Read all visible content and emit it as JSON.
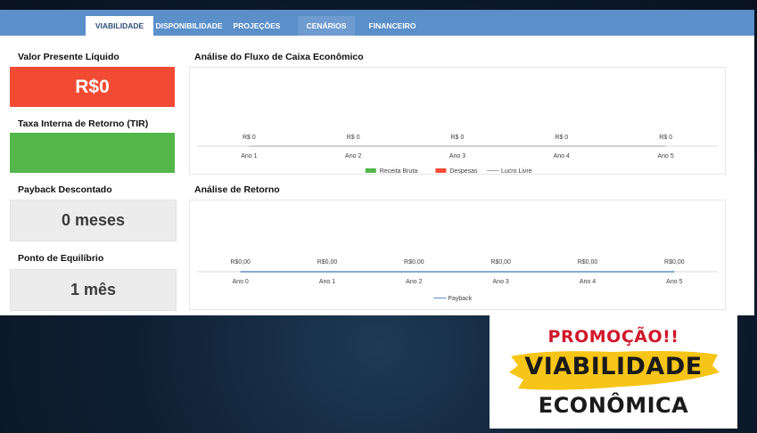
{
  "tabs": [
    {
      "label": "VIABILIDADE",
      "active": true
    },
    {
      "label": "DISPONIBILIDADE",
      "active": false
    },
    {
      "label": "PROJEÇÕES",
      "active": false
    },
    {
      "label": "CENÁRIOS",
      "active": false
    },
    {
      "label": "FINANCEIRO",
      "active": false
    }
  ],
  "kpis": {
    "vpl": {
      "label": "Valor Presente Líquido",
      "value": "R$0"
    },
    "tir": {
      "label": "Taxa Interna de Retorno (TIR)",
      "value": ""
    },
    "payback": {
      "label": "Payback Descontado",
      "value": "0 meses"
    },
    "equilibrio": {
      "label": "Ponto de Equilíbrio",
      "value": "1 mês"
    }
  },
  "colors": {
    "tabbar": "#5b8fc9",
    "red": "#f14b34",
    "green": "#54b74a",
    "line_gray": "#a5a5a5",
    "line_blue": "#5b8fc9"
  },
  "chart_data": [
    {
      "type": "bar",
      "title": "Análise do Fluxo de Caixa Econômico",
      "categories": [
        "Ano 1",
        "Ano 2",
        "Ano 3",
        "Ano 4",
        "Ano 5"
      ],
      "data_labels": [
        "R$ 0",
        "R$ 0",
        "R$ 0",
        "R$ 0",
        "R$ 0"
      ],
      "series": [
        {
          "name": "Receita Bruta",
          "type": "bar",
          "color": "#54b74a",
          "values": [
            0,
            0,
            0,
            0,
            0
          ]
        },
        {
          "name": "Despesas",
          "type": "bar",
          "color": "#f14b34",
          "values": [
            0,
            0,
            0,
            0,
            0
          ]
        },
        {
          "name": "Lucro Livre",
          "type": "line",
          "color": "#a5a5a5",
          "values": [
            0,
            0,
            0,
            0,
            0
          ]
        }
      ],
      "legend": "bottom",
      "grid": false
    },
    {
      "type": "line",
      "title": "Análise de Retorno",
      "categories": [
        "Ano 0",
        "Ano 1",
        "Ano 2",
        "Ano 3",
        "Ano 4",
        "Ano 5"
      ],
      "data_labels": [
        "R$0,00",
        "R$0,00",
        "R$0,00",
        "R$0,00",
        "R$0,00",
        "R$0,00"
      ],
      "series": [
        {
          "name": "Payback",
          "type": "line",
          "color": "#5b8fc9",
          "values": [
            0,
            0,
            0,
            0,
            0,
            0
          ]
        }
      ],
      "legend": "bottom",
      "grid": false
    }
  ],
  "promo": {
    "top": "PROMOÇÃO!!",
    "mid": "VIABILIDADE",
    "bottom": "ECONÔMICA"
  }
}
